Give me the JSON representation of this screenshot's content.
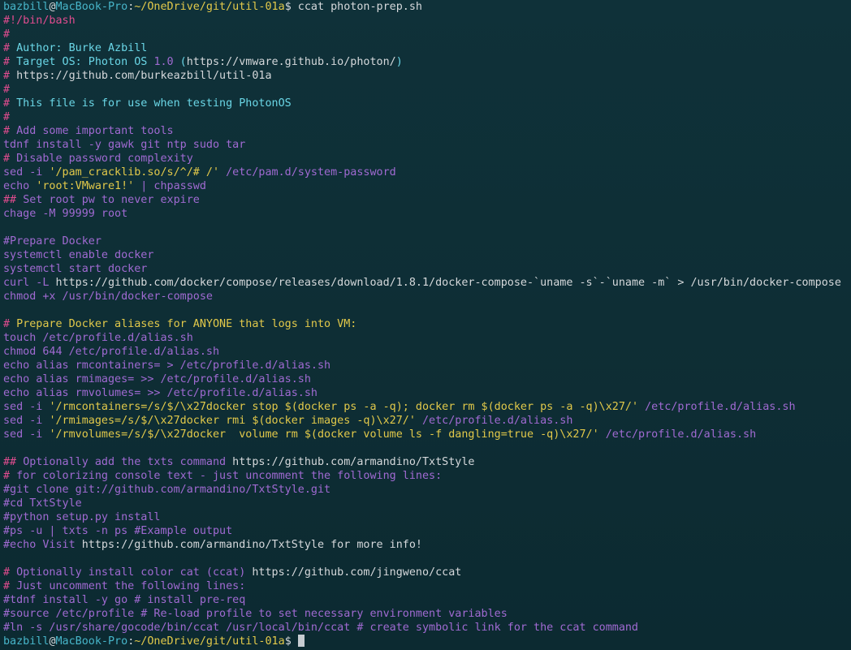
{
  "window": {
    "user": "bazbill",
    "host": "MacBook-Pro",
    "path": "~/OneDrive/git/util-01a",
    "command": "ccat photon-prep.sh"
  },
  "colors": {
    "comment": "#6ad6e6",
    "keyword": "#a06ad2",
    "string": "#e2c94a",
    "prompt_user": "#6ad6e6",
    "prompt_path": "#e2c94a",
    "background": "#0f3139"
  },
  "lines": [
    [
      {
        "t": "bazbill",
        "c": "teal"
      },
      {
        "t": "@",
        "c": "white"
      },
      {
        "t": "MacBook-Pro",
        "c": "teal"
      },
      {
        "t": ":",
        "c": "white"
      },
      {
        "t": "~/OneDrive/git/util-01a",
        "c": "yellow"
      },
      {
        "t": "$ ccat photon-prep.sh",
        "c": "white"
      }
    ],
    [
      {
        "t": "#!/bin/bash",
        "c": "pink"
      }
    ],
    [
      {
        "t": "#",
        "c": "pink"
      }
    ],
    [
      {
        "t": "# ",
        "c": "pink"
      },
      {
        "t": "Author: ",
        "c": "cyan"
      },
      {
        "t": "Burke Azbill",
        "c": "cyan"
      }
    ],
    [
      {
        "t": "# ",
        "c": "pink"
      },
      {
        "t": "Target OS: Photon OS ",
        "c": "cyan"
      },
      {
        "t": "1.0",
        "c": "purple"
      },
      {
        "t": " (",
        "c": "cyan"
      },
      {
        "t": "https://vmware.github.io/photon/",
        "c": "white"
      },
      {
        "t": ")",
        "c": "cyan"
      }
    ],
    [
      {
        "t": "# ",
        "c": "pink"
      },
      {
        "t": "https://github.com/burkeazbill/util-01a",
        "c": "white"
      }
    ],
    [
      {
        "t": "#",
        "c": "pink"
      }
    ],
    [
      {
        "t": "# ",
        "c": "pink"
      },
      {
        "t": "This file is for use when testing PhotonOS",
        "c": "cyan"
      }
    ],
    [
      {
        "t": "#",
        "c": "pink"
      }
    ],
    [
      {
        "t": "# ",
        "c": "pink"
      },
      {
        "t": "Add some important tools",
        "c": "purple"
      }
    ],
    [
      {
        "t": "tdnf install -y gawk git ntp sudo tar",
        "c": "purple"
      }
    ],
    [
      {
        "t": "# ",
        "c": "pink"
      },
      {
        "t": "Disable password complexity",
        "c": "purple"
      }
    ],
    [
      {
        "t": "sed -i ",
        "c": "purple"
      },
      {
        "t": "'/pam_cracklib.so/s/^/# /'",
        "c": "yellow"
      },
      {
        "t": " /etc/pam.d/system-password",
        "c": "purple"
      }
    ],
    [
      {
        "t": "echo ",
        "c": "purple"
      },
      {
        "t": "'root:VMware1!'",
        "c": "yellow"
      },
      {
        "t": " | chpasswd",
        "c": "purple"
      }
    ],
    [
      {
        "t": "## ",
        "c": "pink"
      },
      {
        "t": "Set root pw to never expire",
        "c": "purple"
      }
    ],
    [
      {
        "t": "chage -M 99999 root",
        "c": "purple"
      }
    ],
    [
      {
        "t": "",
        "c": "white"
      }
    ],
    [
      {
        "t": "#Prepare Docker",
        "c": "purple"
      }
    ],
    [
      {
        "t": "systemctl enable docker",
        "c": "purple"
      }
    ],
    [
      {
        "t": "systemctl start docker",
        "c": "purple"
      }
    ],
    [
      {
        "t": "curl -L ",
        "c": "purple"
      },
      {
        "t": "https://github.com/docker/compose/releases/download/1.8.1/docker-compose-`uname -s`-`uname -m` > /usr/bin/docker-compose",
        "c": "white"
      }
    ],
    [
      {
        "t": "chmod +x /usr/bin/docker-compose",
        "c": "purple"
      }
    ],
    [
      {
        "t": "",
        "c": "white"
      }
    ],
    [
      {
        "t": "# ",
        "c": "pink"
      },
      {
        "t": "Prepare Docker aliases for ANYONE that logs into VM:",
        "c": "yellow"
      }
    ],
    [
      {
        "t": "touch /etc/profile.d/alias.sh",
        "c": "purple"
      }
    ],
    [
      {
        "t": "chmod 644 /etc/profile.d/alias.sh",
        "c": "purple"
      }
    ],
    [
      {
        "t": "echo alias rmcontainers= > /etc/profile.d/alias.sh",
        "c": "purple"
      }
    ],
    [
      {
        "t": "echo alias rmimages= >> /etc/profile.d/alias.sh",
        "c": "purple"
      }
    ],
    [
      {
        "t": "echo alias rmvolumes= >> /etc/profile.d/alias.sh",
        "c": "purple"
      }
    ],
    [
      {
        "t": "sed -i ",
        "c": "purple"
      },
      {
        "t": "'/rmcontainers=/s/$/\\x27docker stop $(docker ps -a -q); docker rm $(docker ps -a -q)\\x27/'",
        "c": "yellow"
      },
      {
        "t": " /etc/profile.d/alias.sh",
        "c": "purple"
      }
    ],
    [
      {
        "t": "sed -i ",
        "c": "purple"
      },
      {
        "t": "'/rmimages=/s/$/\\x27docker rmi $(docker images -q)\\x27/'",
        "c": "yellow"
      },
      {
        "t": " /etc/profile.d/alias.sh",
        "c": "purple"
      }
    ],
    [
      {
        "t": "sed -i ",
        "c": "purple"
      },
      {
        "t": "'/rmvolumes=/s/$/\\x27docker  volume rm $(docker volume ls -f dangling=true -q)\\x27/'",
        "c": "yellow"
      },
      {
        "t": " /etc/profile.d/alias.sh",
        "c": "purple"
      }
    ],
    [
      {
        "t": "",
        "c": "white"
      }
    ],
    [
      {
        "t": "## ",
        "c": "pink"
      },
      {
        "t": "Optionally add the txts command ",
        "c": "purple"
      },
      {
        "t": "https://github.com/armandino/TxtStyle",
        "c": "white"
      }
    ],
    [
      {
        "t": "# ",
        "c": "pink"
      },
      {
        "t": "for colorizing console text - just uncomment the following lines:",
        "c": "purple"
      }
    ],
    [
      {
        "t": "#git clone git://github.com/armandino/TxtStyle.git",
        "c": "purple"
      }
    ],
    [
      {
        "t": "#cd TxtStyle",
        "c": "purple"
      }
    ],
    [
      {
        "t": "#python setup.py install",
        "c": "purple"
      }
    ],
    [
      {
        "t": "#ps -u | txts -n ps #Example output",
        "c": "purple"
      }
    ],
    [
      {
        "t": "#echo Visit ",
        "c": "purple"
      },
      {
        "t": "https://github.com/armandino/TxtStyle for more info!",
        "c": "white"
      }
    ],
    [
      {
        "t": "",
        "c": "white"
      }
    ],
    [
      {
        "t": "# ",
        "c": "pink"
      },
      {
        "t": "Optionally install color cat (ccat) ",
        "c": "purple"
      },
      {
        "t": "https://github.com/jingweno/ccat",
        "c": "white"
      }
    ],
    [
      {
        "t": "# ",
        "c": "pink"
      },
      {
        "t": "Just uncomment the following lines:",
        "c": "purple"
      }
    ],
    [
      {
        "t": "#tdnf install -y go # install pre-req",
        "c": "purple"
      }
    ],
    [
      {
        "t": "#source /etc/profile # Re-load profile to set necessary environment variables",
        "c": "purple"
      }
    ],
    [
      {
        "t": "#ln -s /usr/share/gocode/bin/ccat /usr/local/bin/ccat # create symbolic link for the ccat command",
        "c": "purple"
      }
    ],
    [
      {
        "t": "bazbill",
        "c": "teal"
      },
      {
        "t": "@",
        "c": "white"
      },
      {
        "t": "MacBook-Pro",
        "c": "teal"
      },
      {
        "t": ":",
        "c": "white"
      },
      {
        "t": "~/OneDrive/git/util-01a",
        "c": "yellow"
      },
      {
        "t": "$ ",
        "c": "white"
      }
    ]
  ]
}
